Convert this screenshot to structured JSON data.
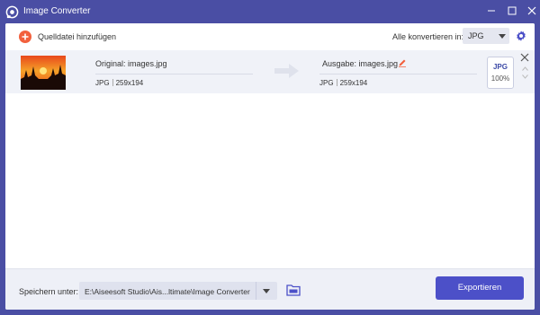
{
  "window": {
    "title": "Image Converter",
    "minimize_icon": "minimize-icon",
    "maximize_icon": "maximize-icon",
    "close_icon": "close-icon"
  },
  "toolbar": {
    "add_label": "Quelldatei hinzufügen",
    "convert_all_label": "Alle konvertieren in:",
    "convert_all_value": "JPG",
    "settings_icon": "gear-icon"
  },
  "files": [
    {
      "original_label": "Original: images.jpg",
      "original_format": "JPG",
      "original_size": "259x194",
      "output_label": "Ausgabe: images.jpg",
      "output_format": "JPG",
      "output_size": "259x194",
      "badge_format": "JPG",
      "badge_quality": "100%"
    }
  ],
  "footer": {
    "save_label": "Speichern unter:",
    "path_value": "E:\\Aiseesoft Studio\\Ais...ltimate\\Image Converter",
    "export_label": "Exportieren"
  },
  "colors": {
    "accent": "#4a4ea4",
    "add_button": "#f2603d",
    "export_button": "#4c50c8",
    "row_background": "#f0f2f8"
  }
}
